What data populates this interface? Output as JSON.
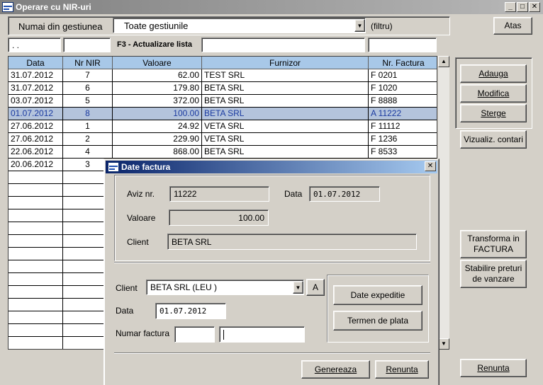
{
  "window": {
    "title": "Operare cu NIR-uri"
  },
  "filter": {
    "label": "Numai din gestiunea",
    "value": "Toate gestiunile",
    "hint": "(filtru)",
    "date_input": " . .",
    "f3_label": "F3 - Actualizare lista"
  },
  "buttons": {
    "atas": "Atas",
    "adauga": "Adauga",
    "modifica": "Modifica",
    "sterge": "Sterge",
    "vizualiz": "Vizualiz. contari",
    "transforma_line1": "Transforma in",
    "transforma_line2": "FACTURA",
    "stabilire_line1": "Stabilire preturi",
    "stabilire_line2": "de vanzare",
    "renunta": "Renunta"
  },
  "table": {
    "columns": [
      "Data",
      "Nr NIR",
      "Valoare",
      "Furnizor",
      "Nr. Factura"
    ],
    "rows": [
      [
        "31.07.2012",
        "7",
        "62.00",
        "TEST SRL",
        "F 0201"
      ],
      [
        "31.07.2012",
        "6",
        "179.80",
        "BETA SRL",
        "F 1020"
      ],
      [
        "03.07.2012",
        "5",
        "372.00",
        "BETA SRL",
        "F 8888"
      ],
      [
        "01.07.2012",
        "8",
        "100.00",
        "BETA SRL",
        "A  11222"
      ],
      [
        "27.06.2012",
        "1",
        "24.92",
        "VETA SRL",
        "F 11112"
      ],
      [
        "27.06.2012",
        "2",
        "229.90",
        "VETA SRL",
        "F 1236"
      ],
      [
        "22.06.2012",
        "4",
        "868.00",
        "BETA SRL",
        "F 8533"
      ],
      [
        "20.06.2012",
        "3",
        "",
        "",
        ""
      ]
    ],
    "selected_row": 3
  },
  "dialog": {
    "title": "Date factura",
    "aviz_label": "Aviz nr.",
    "aviz_value": "11222",
    "data_label": "Data",
    "data_value": "01.07.2012",
    "valoare_label": "Valoare",
    "valoare_value": "100.00",
    "client_label": "Client",
    "client_value": "BETA SRL",
    "client_select_label": "Client",
    "client_select_value": "BETA SRL (LEU )",
    "a_button": "A",
    "data2_label": "Data",
    "data2_value": "01.07.2012",
    "numar_label": "Numar factura",
    "numar_series": "",
    "numar_value": "",
    "date_expeditie": "Date expeditie",
    "termen_plata": "Termen de plata",
    "genereaza": "Genereaza",
    "renunta": "Renunta"
  },
  "colors": {
    "selected_row_bg": "#b4c4dc",
    "header_bg": "#a8c8e8",
    "dialog_title": "#0a246a"
  }
}
